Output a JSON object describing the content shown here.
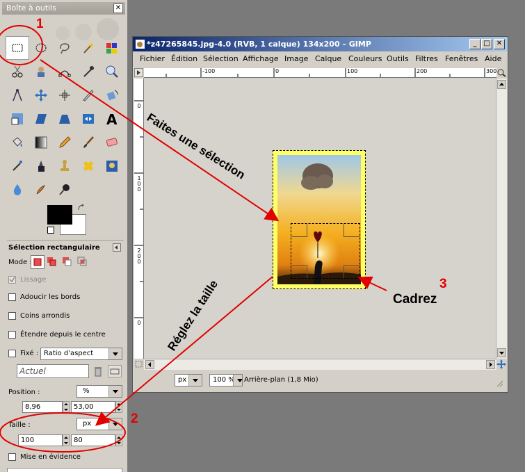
{
  "toolbox": {
    "title": "Boîte à outils",
    "close": "✕",
    "options_title": "Sélection rectangulaire",
    "mode_label": "Mode :",
    "antialias_label": "Lissage",
    "feather_label": "Adoucir les bords",
    "rounded_label": "Coins arrondis",
    "center_label": "Étendre depuis le centre",
    "fixed_label": "Fixé :",
    "fixed_value": "Ratio d'aspect",
    "current_value": "Actuel",
    "position_label": "Position :",
    "position_unit": "%",
    "pos_x": "8,96",
    "pos_y": "53,00",
    "size_label": "Taille :",
    "size_unit": "px",
    "size_w": "100",
    "size_h": "80",
    "highlight_label": "Mise en évidence"
  },
  "window": {
    "title": "*z47265845.jpg-4.0 (RVB, 1 calque) 134x200 – GIMP",
    "menu": [
      "Fichier",
      "Édition",
      "Sélection",
      "Affichage",
      "Image",
      "Calque",
      "Couleurs",
      "Outils",
      "Filtres",
      "Fenêtres",
      "Aide"
    ],
    "ruler_top": [
      "-100",
      "0",
      "100",
      "200",
      "300"
    ],
    "ruler_left_0": "0",
    "ruler_left_1": "100",
    "ruler_left_2": "200",
    "status_unit": "px",
    "zoom": "100 %",
    "status_text": "Arrière-plan (1,8 Mio)"
  },
  "annotations": {
    "step1_num": "1",
    "step2_num": "2",
    "step3_num": "3",
    "step1_text": "Faites une sélection",
    "step2_text": "Réglez la taille",
    "step3_text": "Cadrez"
  },
  "colors": {
    "annotation": "#e00000",
    "titlebar": "#0a246a"
  }
}
